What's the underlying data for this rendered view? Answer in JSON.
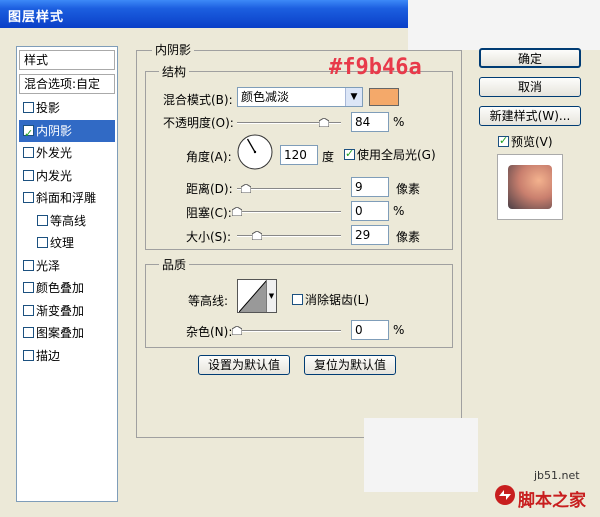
{
  "window": {
    "title": "图层样式"
  },
  "annotation": {
    "text": "#f9b46a",
    "color": "#f9b46a"
  },
  "watermark": {
    "site": "jb51.net",
    "brand": "脚本之家"
  },
  "colors": {
    "swatch": "#f4a96a",
    "selection": "#316ac5",
    "annotation": "#e83a4a"
  },
  "style_list": {
    "header": "样式",
    "blend_options": "混合选项:自定",
    "items": [
      {
        "label": "投影",
        "checked": false,
        "indent": false
      },
      {
        "label": "内阴影",
        "checked": true,
        "indent": false,
        "selected": true
      },
      {
        "label": "外发光",
        "checked": false,
        "indent": false
      },
      {
        "label": "内发光",
        "checked": false,
        "indent": false
      },
      {
        "label": "斜面和浮雕",
        "checked": false,
        "indent": false
      },
      {
        "label": "等高线",
        "checked": false,
        "indent": true
      },
      {
        "label": "纹理",
        "checked": false,
        "indent": true
      },
      {
        "label": "光泽",
        "checked": false,
        "indent": false
      },
      {
        "label": "颜色叠加",
        "checked": false,
        "indent": false
      },
      {
        "label": "渐变叠加",
        "checked": false,
        "indent": false
      },
      {
        "label": "图案叠加",
        "checked": false,
        "indent": false
      },
      {
        "label": "描边",
        "checked": false,
        "indent": false
      }
    ]
  },
  "panel": {
    "section_title": "内阴影",
    "structure": {
      "label": "结构",
      "blend_mode_label": "混合模式(B):",
      "blend_mode_value": "颜色减淡",
      "opacity_label": "不透明度(O):",
      "opacity_value": "84",
      "opacity_unit": "%",
      "opacity_fraction": 0.84,
      "angle_label": "角度(A):",
      "angle_value": "120",
      "angle_unit": "度",
      "global_light_label": "使用全局光(G)",
      "global_light_checked": true,
      "distance_label": "距离(D):",
      "distance_value": "9",
      "distance_unit": "像素",
      "distance_fraction": 0.09,
      "choke_label": "阻塞(C):",
      "choke_value": "0",
      "choke_unit": "%",
      "choke_fraction": 0.0,
      "size_label": "大小(S):",
      "size_value": "29",
      "size_unit": "像素",
      "size_fraction": 0.19
    },
    "quality": {
      "label": "品质",
      "contour_label": "等高线:",
      "antialias_label": "消除锯齿(L)",
      "antialias_checked": false,
      "noise_label": "杂色(N):",
      "noise_value": "0",
      "noise_unit": "%",
      "noise_fraction": 0.0
    },
    "set_default_label": "设置为默认值",
    "reset_default_label": "复位为默认值"
  },
  "right_panel": {
    "ok_label": "确定",
    "cancel_label": "取消",
    "new_style_label": "新建样式(W)...",
    "preview_label": "预览(V)",
    "preview_checked": true
  }
}
